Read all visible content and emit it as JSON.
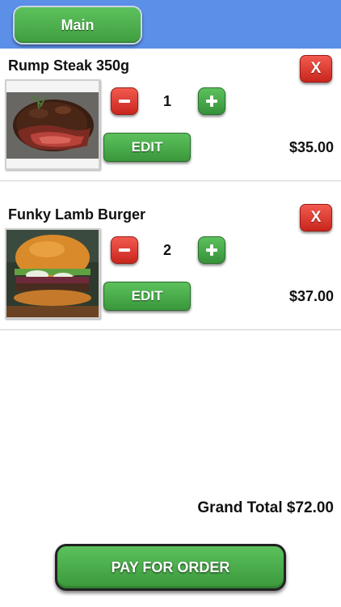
{
  "header": {
    "main_label": "Main",
    "bar_color": "#5b8fe8"
  },
  "cart": {
    "items": [
      {
        "title": "Rump Steak 350g",
        "remove_label": "X",
        "quantity": "1",
        "edit_label": "EDIT",
        "price": "$35.00",
        "image_icon": "steak-photo"
      },
      {
        "title": "Funky Lamb Burger",
        "remove_label": "X",
        "quantity": "2",
        "edit_label": "EDIT",
        "price": "$37.00",
        "image_icon": "burger-photo"
      }
    ]
  },
  "footer": {
    "grand_total": "Grand Total $72.00",
    "pay_label": "PAY FOR ORDER"
  },
  "colors": {
    "accent_green": "#4caf50",
    "remove_red": "#e53935"
  }
}
